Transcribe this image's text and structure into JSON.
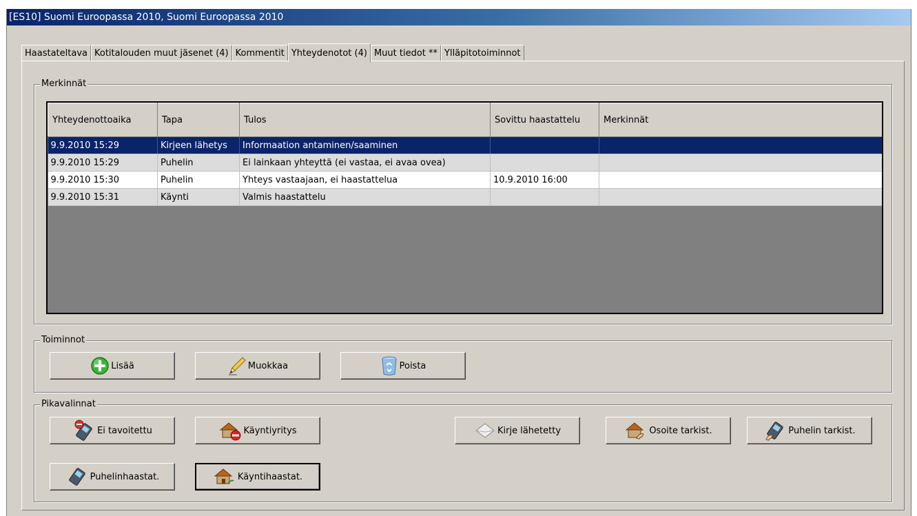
{
  "window": {
    "title": "[ES10] Suomi Euroopassa 2010, Suomi Euroopassa 2010"
  },
  "tabs": [
    {
      "label": "Haastateltava"
    },
    {
      "label": "Kotitalouden muut jäsenet (4)"
    },
    {
      "label": "Kommentit"
    },
    {
      "label": "Yhteydenotot (4)"
    },
    {
      "label": "Muut tiedot **"
    },
    {
      "label": "Ylläpitotoiminnot"
    }
  ],
  "merkinnat": {
    "legend": "Merkinnät",
    "columns": [
      "Yhteydenottoaika",
      "Tapa",
      "Tulos",
      "Sovittu haastattelu",
      "Merkinnät"
    ],
    "rows": [
      [
        "9.9.2010 15:29",
        "Kirjeen lähetys",
        "Informaation antaminen/saaminen",
        "",
        ""
      ],
      [
        "9.9.2010 15:29",
        "Puhelin",
        "Ei lainkaan yhteyttä (ei vastaa, ei avaa ovea)",
        "",
        ""
      ],
      [
        "9.9.2010 15:30",
        "Puhelin",
        "Yhteys vastaajaan, ei haastattelua",
        "10.9.2010 16:00",
        ""
      ],
      [
        "9.9.2010 15:31",
        "Käynti",
        "Valmis haastattelu",
        "",
        ""
      ]
    ]
  },
  "toiminnot": {
    "legend": "Toiminnot",
    "add": "Lisää",
    "edit": "Muokkaa",
    "delete": "Poista"
  },
  "pikavalinnat": {
    "legend": "Pikavalinnat",
    "not_reached": "Ei tavoitettu",
    "visit_attempt": "Käyntiyritys",
    "letter_sent": "Kirje lähetetty",
    "address_check": "Osoite tarkist.",
    "phone_check": "Puhelin tarkist.",
    "phone_interview": "Puhelinhaastat.",
    "visit_interview": "Käyntihaastat."
  }
}
